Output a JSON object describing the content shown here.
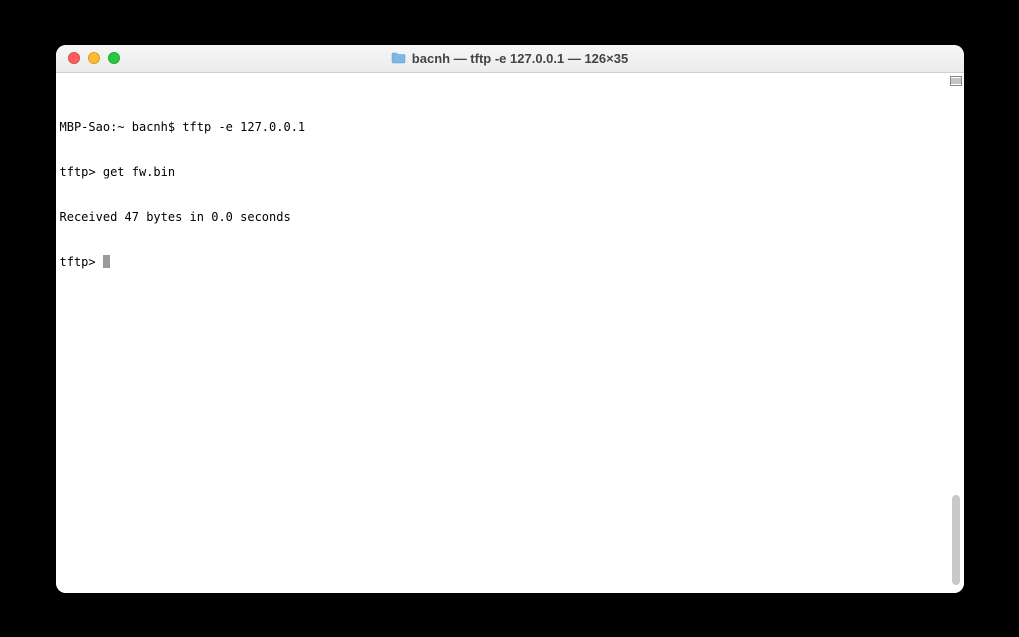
{
  "window": {
    "title": "bacnh — tftp -e 127.0.0.1 — 126×35"
  },
  "terminal": {
    "lines": [
      "MBP-Sao:~ bacnh$ tftp -e 127.0.0.1",
      "tftp> get fw.bin",
      "Received 47 bytes in 0.0 seconds"
    ],
    "prompt": "tftp> "
  }
}
